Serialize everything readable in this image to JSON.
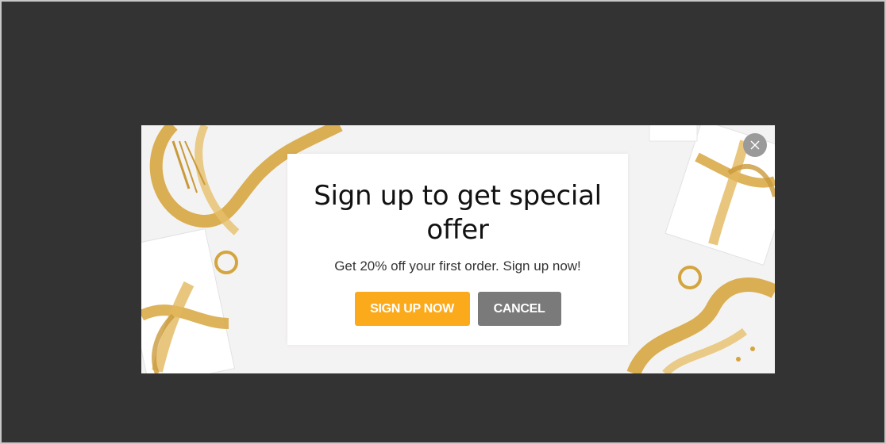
{
  "popup": {
    "title": "Sign up to get special offer",
    "subtitle": "Get 20% off your first order. Sign up now!",
    "signup_label": "SIGN UP NOW",
    "cancel_label": "CANCEL",
    "close_icon": "close-icon"
  },
  "colors": {
    "overlay": "#333333",
    "signup_button": "#fbaa1c",
    "cancel_button": "#7a7a7a",
    "close_button": "#9a9a9a",
    "ribbon_gold": "#d7a640"
  }
}
